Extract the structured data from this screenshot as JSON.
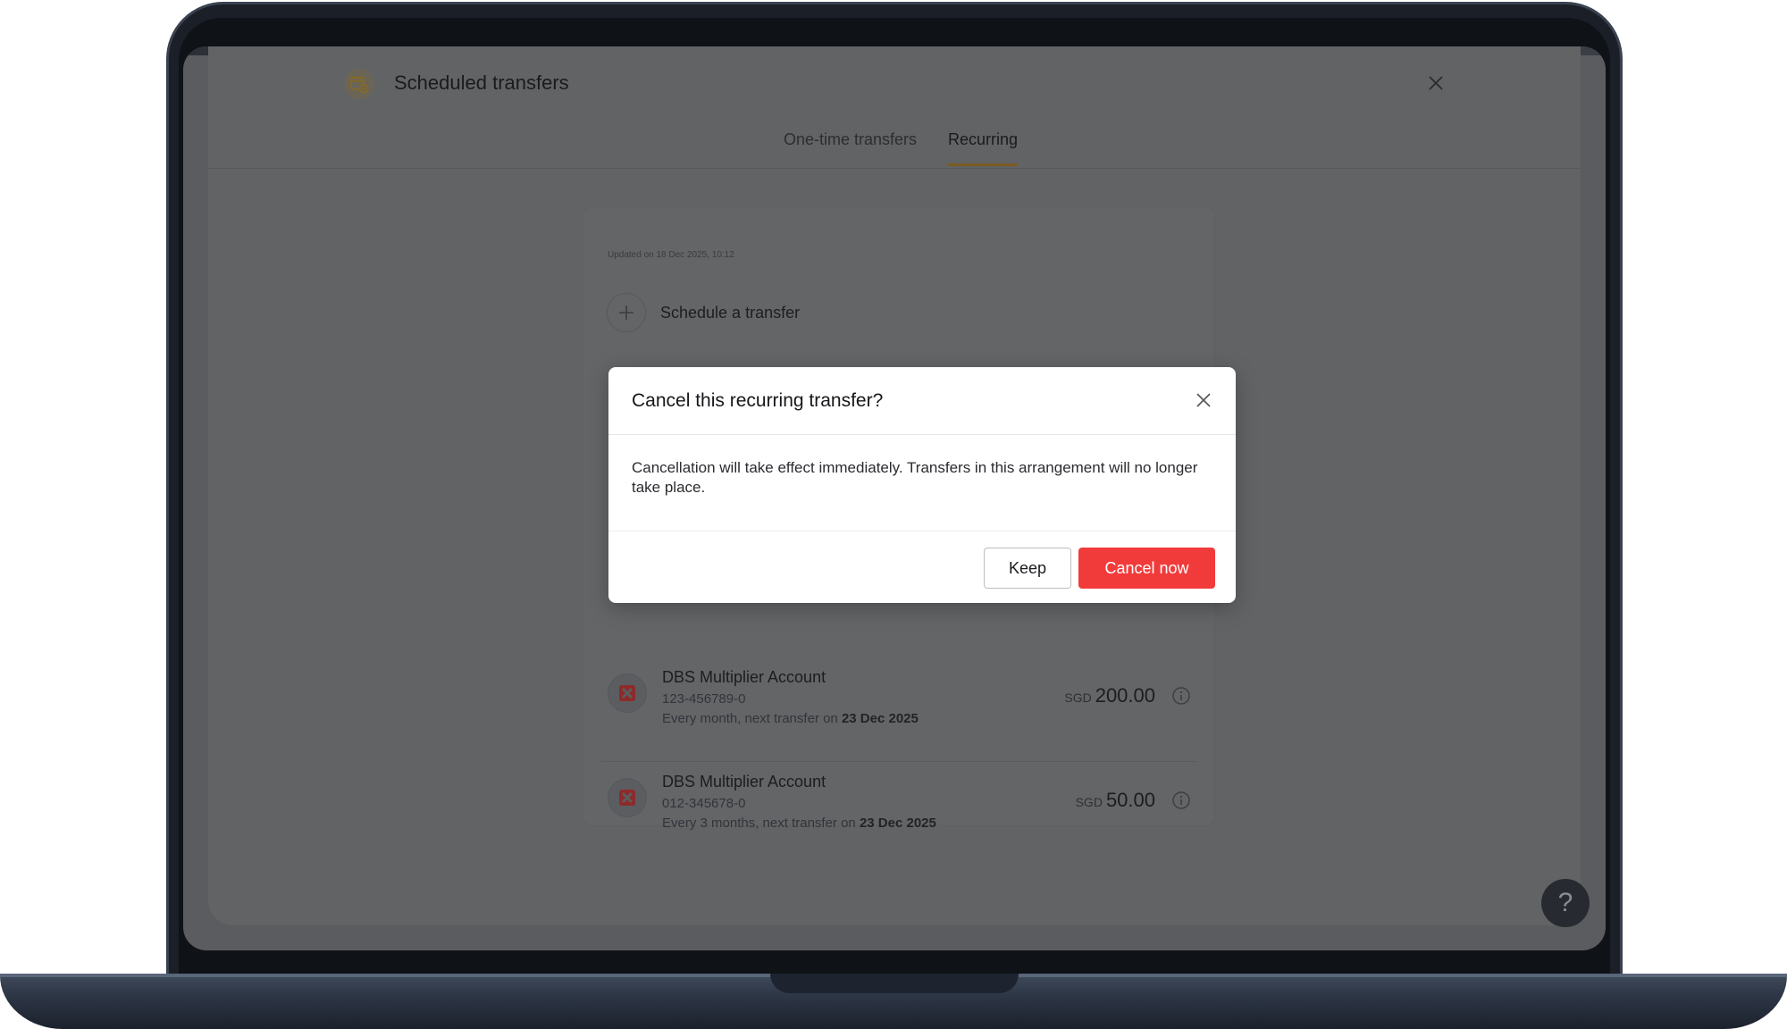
{
  "panel": {
    "title": "Scheduled transfers",
    "tabs": [
      {
        "label": "One-time transfers",
        "active": false
      },
      {
        "label": "Recurring",
        "active": true
      }
    ]
  },
  "content": {
    "updated_text": "Updated on 18 Dec 2025, 10:12",
    "schedule_label": "Schedule a transfer",
    "transfers": [
      {
        "name": "DBS Multiplier Account",
        "account": "123-456789-0",
        "schedule_prefix": "Every month, next transfer on ",
        "next_date": "23 Dec 2025",
        "currency": "SGD",
        "amount": "200.00"
      },
      {
        "name": "DBS Multiplier Account",
        "account": "012-345678-0",
        "schedule_prefix": "Every 3 months, next transfer on ",
        "next_date": "23 Dec 2025",
        "currency": "SGD",
        "amount": "50.00"
      }
    ]
  },
  "modal": {
    "title": "Cancel this recurring transfer?",
    "body": "Cancellation will take effect immediately. Transfers in this arrangement will no longer take place.",
    "keep_label": "Keep",
    "cancel_label": "Cancel now"
  },
  "help_label": "?",
  "icons": {
    "header": "calendar-transfer-icon",
    "close": "close-icon",
    "add": "plus-icon",
    "bank": "dbs-logo-icon",
    "info": "info-icon",
    "help": "help-icon"
  },
  "colors": {
    "accent": "#f13b3b",
    "tab_underline": "#7a5b22",
    "overlay": "#5b5c60"
  }
}
